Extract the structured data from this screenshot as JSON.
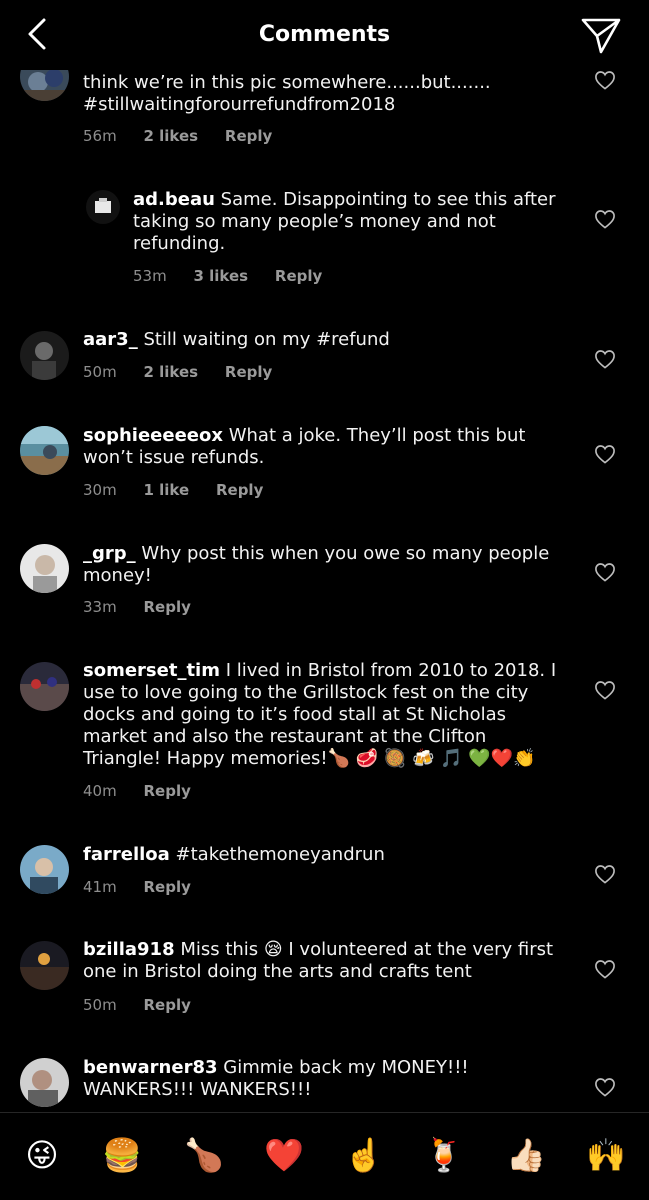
{
  "header": {
    "title": "Comments",
    "back_icon": "chevron-left-icon",
    "send_icon": "paper-plane-icon"
  },
  "comments": [
    {
      "user": "",
      "text": "think we’re in this pic somewhere......but....... #stillwaitingforourrefundfrom2018",
      "time": "56m",
      "likes": "2 likes",
      "reply": "Reply"
    },
    {
      "user": "ad.beau",
      "text": "Same. Disappointing to see this after taking so many people’s money and not refunding.",
      "time": "53m",
      "likes": "3 likes",
      "reply": "Reply"
    },
    {
      "user": "aar3_",
      "text": "Still waiting on my #refund",
      "time": "50m",
      "likes": "2 likes",
      "reply": "Reply"
    },
    {
      "user": "sophieeeeeox",
      "text": "What a joke. They’ll post this but won’t issue refunds.",
      "time": "30m",
      "likes": "1 like",
      "reply": "Reply"
    },
    {
      "user": "_grp_",
      "text": "Why post this when you owe so many people money!",
      "time": "33m",
      "likes": "",
      "reply": "Reply"
    },
    {
      "user": "somerset_tim",
      "text": "I lived in Bristol from 2010 to 2018. I use to love going to the Grillstock fest on the city docks and going to it’s food stall at St Nicholas market and also the restaurant at the Clifton Triangle! Happy memories!🍗 🥩 🥘 🍻 🎵 💚❤️👏",
      "time": "40m",
      "likes": "",
      "reply": "Reply"
    },
    {
      "user": "farrelloa",
      "text": "#takethemoneyandrun",
      "time": "41m",
      "likes": "",
      "reply": "Reply"
    },
    {
      "user": "bzilla918",
      "text": "Miss this 😪 I volunteered at the very first one in Bristol doing the arts and crafts tent",
      "time": "50m",
      "likes": "",
      "reply": "Reply"
    },
    {
      "user": "benwarner83",
      "text": "Gimmie back my MONEY!!! WANKERS!!! WANKERS!!!",
      "time": "",
      "likes": "",
      "reply": ""
    }
  ],
  "emoji_bar": [
    "😜",
    "🍔",
    "🍗",
    "❤️",
    "☝️",
    "🍹",
    "👍🏻",
    "🙌"
  ],
  "colors": {
    "background": "#000000",
    "text": "#ffffff",
    "meta": "#8e8e8e",
    "divider": "#262626"
  }
}
